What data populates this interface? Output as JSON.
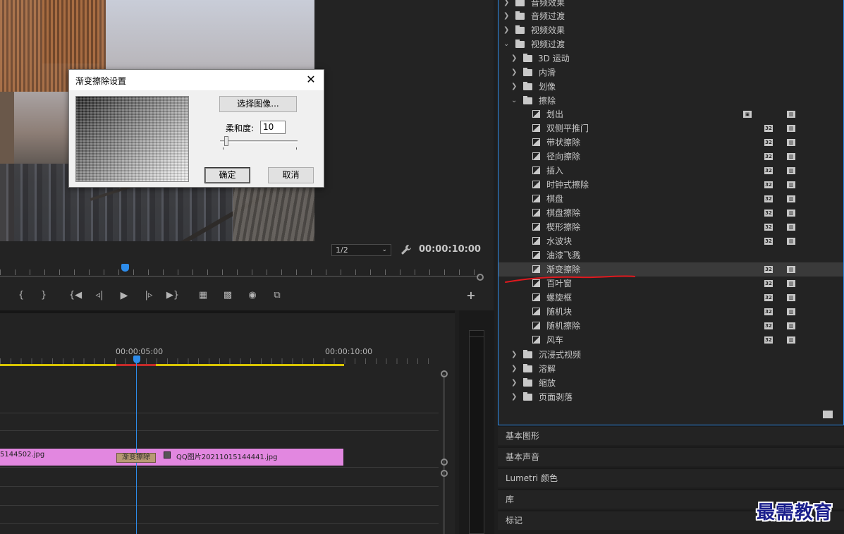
{
  "monitor": {
    "zoom": "1/2",
    "timecode": "00:00:10:00"
  },
  "timeline": {
    "tc_labels": [
      "00:00:05:00",
      "00:00:10:00"
    ],
    "clip_a_name": "5144502.jpg",
    "clip_b_name": "QQ图片20211015144441.jpg",
    "transition_name": "渐变擦除"
  },
  "effects": {
    "top_folders": [
      "音频效果",
      "音频过渡",
      "视频效果",
      "视频过渡"
    ],
    "sub_folders_top": [
      "3D 运动",
      "内滑",
      "划像",
      "擦除"
    ],
    "wipe_items": [
      "划出",
      "双侧平推门",
      "带状擦除",
      "径向擦除",
      "插入",
      "时钟式擦除",
      "棋盘",
      "棋盘擦除",
      "楔形擦除",
      "水波块",
      "油漆飞溅",
      "渐变擦除",
      "百叶窗",
      "螺旋框",
      "随机块",
      "随机擦除",
      "风车"
    ],
    "sub_folders_bottom": [
      "沉浸式视频",
      "溶解",
      "缩放",
      "页面剥落"
    ],
    "selected_item": "渐变擦除"
  },
  "side_panels": [
    "基本图形",
    "基本声音",
    "Lumetri 颜色",
    "库",
    "标记"
  ],
  "watermark": "最需教育",
  "dialog": {
    "title": "渐变擦除设置",
    "choose_image_label": "选择图像...",
    "softness_label": "柔和度:",
    "softness_value": "10",
    "ok_label": "确定",
    "cancel_label": "取消"
  },
  "colors": {
    "accent": "#2d8ceb",
    "clip": "#e287e0",
    "work_area": "#d8c400",
    "annotation": "#e0191e"
  }
}
